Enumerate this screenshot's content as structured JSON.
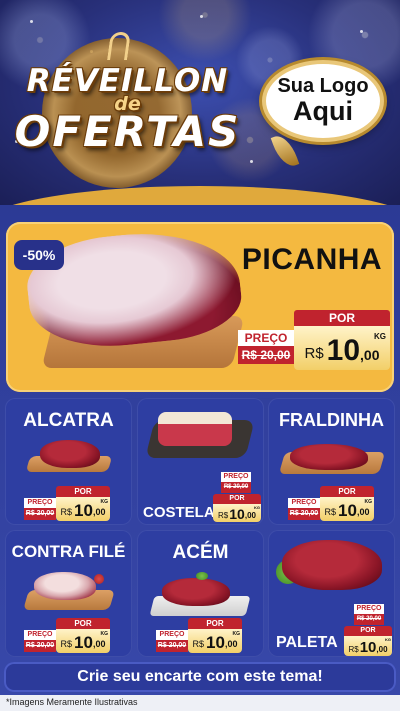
{
  "header": {
    "title_line1": "RÉVEILLON",
    "title_line2": "de",
    "title_line3": "OFERTAS",
    "logo_line1": "Sua Logo",
    "logo_line2": "Aqui"
  },
  "hero": {
    "discount": "-50%",
    "name": "PICANHA",
    "preco_label": "PREÇO",
    "old_price": "R$ 20,00",
    "por_label": "POR",
    "currency": "R$",
    "price_int": "10",
    "price_dec": ",00",
    "unit": "KG"
  },
  "products": [
    {
      "name": "ALCATRA",
      "preco_label": "PREÇO",
      "old_price": "R$ 20,00",
      "por_label": "POR",
      "currency": "R$",
      "price_int": "10",
      "price_dec": ",00",
      "unit": "KG"
    },
    {
      "name": "COSTELA",
      "preco_label": "PREÇO",
      "old_price": "R$ 20,00",
      "por_label": "POR",
      "currency": "R$",
      "price_int": "10",
      "price_dec": ",00",
      "unit": "KG"
    },
    {
      "name": "FRALDINHA",
      "preco_label": "PREÇO",
      "old_price": "R$ 20,00",
      "por_label": "POR",
      "currency": "R$",
      "price_int": "10",
      "price_dec": ",00",
      "unit": "KG"
    },
    {
      "name": "CONTRA FILÉ",
      "preco_label": "PREÇO",
      "old_price": "R$ 20,00",
      "por_label": "POR",
      "currency": "R$",
      "price_int": "10",
      "price_dec": ",00",
      "unit": "KG"
    },
    {
      "name": "ACÉM",
      "preco_label": "PREÇO",
      "old_price": "R$ 20,00",
      "por_label": "POR",
      "currency": "R$",
      "price_int": "10",
      "price_dec": ",00",
      "unit": "KG"
    },
    {
      "name": "PALETA",
      "preco_label": "PREÇO",
      "old_price": "R$ 20,00",
      "por_label": "POR",
      "currency": "R$",
      "price_int": "10",
      "price_dec": ",00",
      "unit": "KG"
    }
  ],
  "footer": {
    "cta": "Crie seu encarte com este tema!",
    "disclaimer": "*Imagens Meramente Ilustrativas"
  },
  "colors": {
    "navy": "#2c3a95",
    "gold": "#f4b940",
    "red": "#c0232e"
  }
}
